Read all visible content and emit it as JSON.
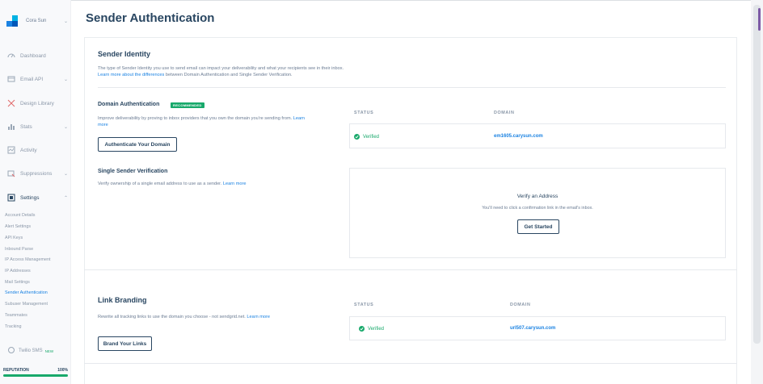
{
  "sidebar": {
    "account_name": "Cora Sun",
    "items": [
      {
        "label": "Dashboard",
        "icon": "dashboard-icon"
      },
      {
        "label": "Email API",
        "icon": "email-api-icon"
      },
      {
        "label": "Design Library",
        "icon": "design-library-icon"
      },
      {
        "label": "Stats",
        "icon": "stats-icon"
      },
      {
        "label": "Activity",
        "icon": "activity-icon"
      },
      {
        "label": "Suppressions",
        "icon": "suppressions-icon"
      },
      {
        "label": "Settings",
        "icon": "settings-icon"
      }
    ],
    "settings_sub": [
      "Account Details",
      "Alert Settings",
      "API Keys",
      "Inbound Parse",
      "IP Access Management",
      "IP Addresses",
      "Mail Settings",
      "Sender Authentication",
      "Subuser Management",
      "Teammates",
      "Tracking"
    ],
    "twilio": {
      "label": "Twilio SMS",
      "badge": "NEW"
    },
    "reputation": {
      "label": "REPUTATION",
      "value": "100%",
      "fill": 1.0
    }
  },
  "page": {
    "title": "Sender Authentication"
  },
  "sender_identity": {
    "heading": "Sender Identity",
    "desc": "The type of Sender Identity you use to send email can impact your deliverability and what your recipients see in their inbox.",
    "link": "Learn more about the differences",
    "desc2": "between Domain Authentication and Single Sender Verification."
  },
  "domain_auth": {
    "heading": "Domain Authentication",
    "badge": "RECOMMENDED",
    "desc": "Improve deliverability by proving to inbox providers that you own the domain you're sending from.",
    "link": "Learn more",
    "button": "Authenticate Your Domain",
    "col_status": "STATUS",
    "col_domain": "DOMAIN",
    "status": "Verified",
    "domain": "em1605.carysun.com"
  },
  "single_sender": {
    "heading": "Single Sender Verification",
    "desc": "Verify ownership of a single email address to use as a sender.",
    "link": "Learn more",
    "box_title": "Verify an Address",
    "box_text": "You'll need to click a confirmation link in the email's inbox.",
    "button": "Get Started"
  },
  "link_branding": {
    "heading": "Link Branding",
    "desc": "Rewrite all tracking links to use the domain you choose - not sendgrid.net.",
    "link": "Learn more",
    "button": "Brand Your Links",
    "col_status": "STATUS",
    "col_domain": "DOMAIN",
    "status": "Verified",
    "domain": "url507.carysun.com"
  }
}
